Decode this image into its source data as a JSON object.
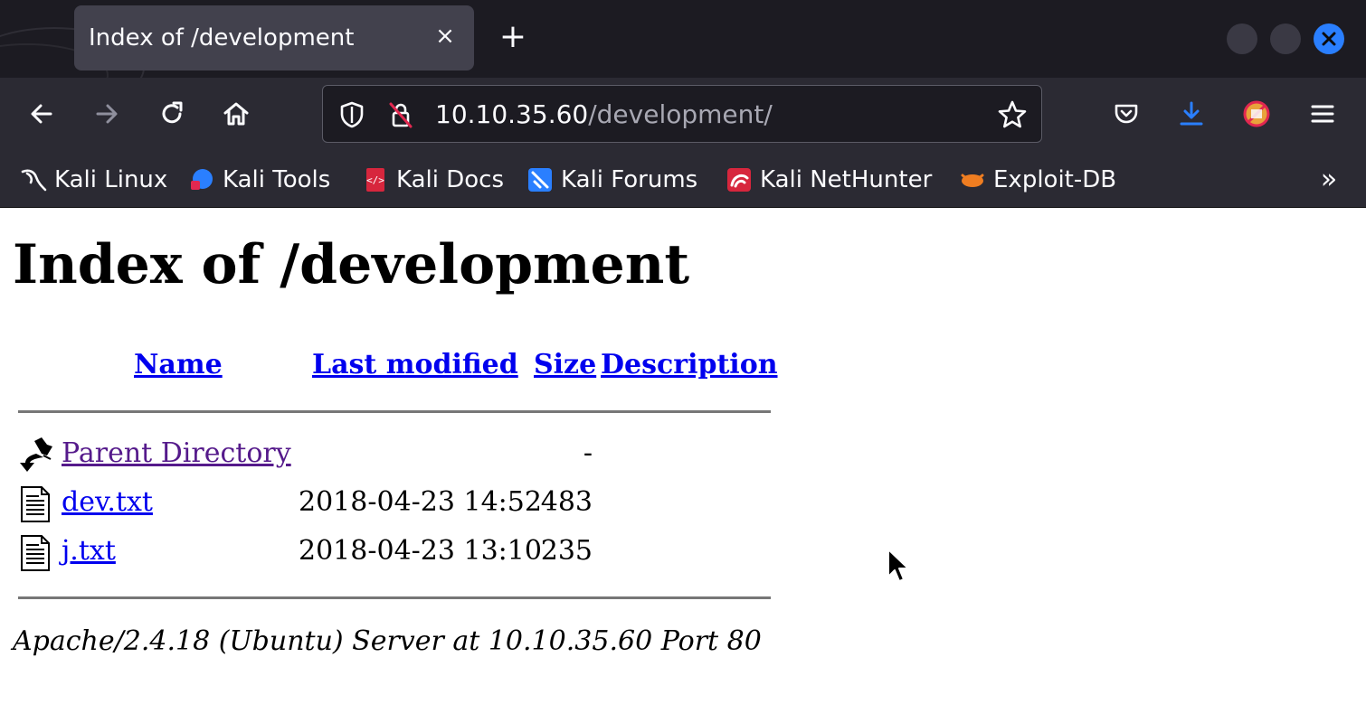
{
  "browser": {
    "tab_title": "Index of /development",
    "tab_close": "×",
    "new_tab": "+",
    "url_host": "10.10.35.60",
    "url_path": "/development/",
    "icons": [
      "back-icon",
      "forward-icon",
      "reload-icon",
      "home-icon",
      "shield-icon",
      "insecure-lock-icon",
      "star-icon",
      "pocket-icon",
      "download-icon",
      "extension-icon",
      "menu-icon"
    ],
    "accent": "#2a7fff"
  },
  "bookmarks": [
    {
      "label": "Kali Linux",
      "icon": "kali-dragon-icon"
    },
    {
      "label": "Kali Tools",
      "icon": "kali-tools-icon"
    },
    {
      "label": "Kali Docs",
      "icon": "kali-docs-icon"
    },
    {
      "label": "Kali Forums",
      "icon": "kali-forums-icon"
    },
    {
      "label": "Kali NetHunter",
      "icon": "nethunter-icon"
    },
    {
      "label": "Exploit-DB",
      "icon": "exploit-db-icon"
    }
  ],
  "bookmarks_overflow": "»",
  "page": {
    "title": "Index of /development",
    "columns": {
      "name": "Name",
      "last_modified": "Last modified",
      "size": "Size",
      "description": "Description"
    },
    "rows": [
      {
        "name": "Parent Directory",
        "modified": "",
        "size": "-",
        "icon": "back-folder-icon"
      },
      {
        "name": "dev.txt",
        "modified": "2018-04-23 14:52",
        "size": "483",
        "icon": "text-file-icon"
      },
      {
        "name": "j.txt",
        "modified": "2018-04-23 13:10",
        "size": "235",
        "icon": "text-file-icon"
      }
    ],
    "footer": "Apache/2.4.18 (Ubuntu) Server at 10.10.35.60 Port 80"
  }
}
